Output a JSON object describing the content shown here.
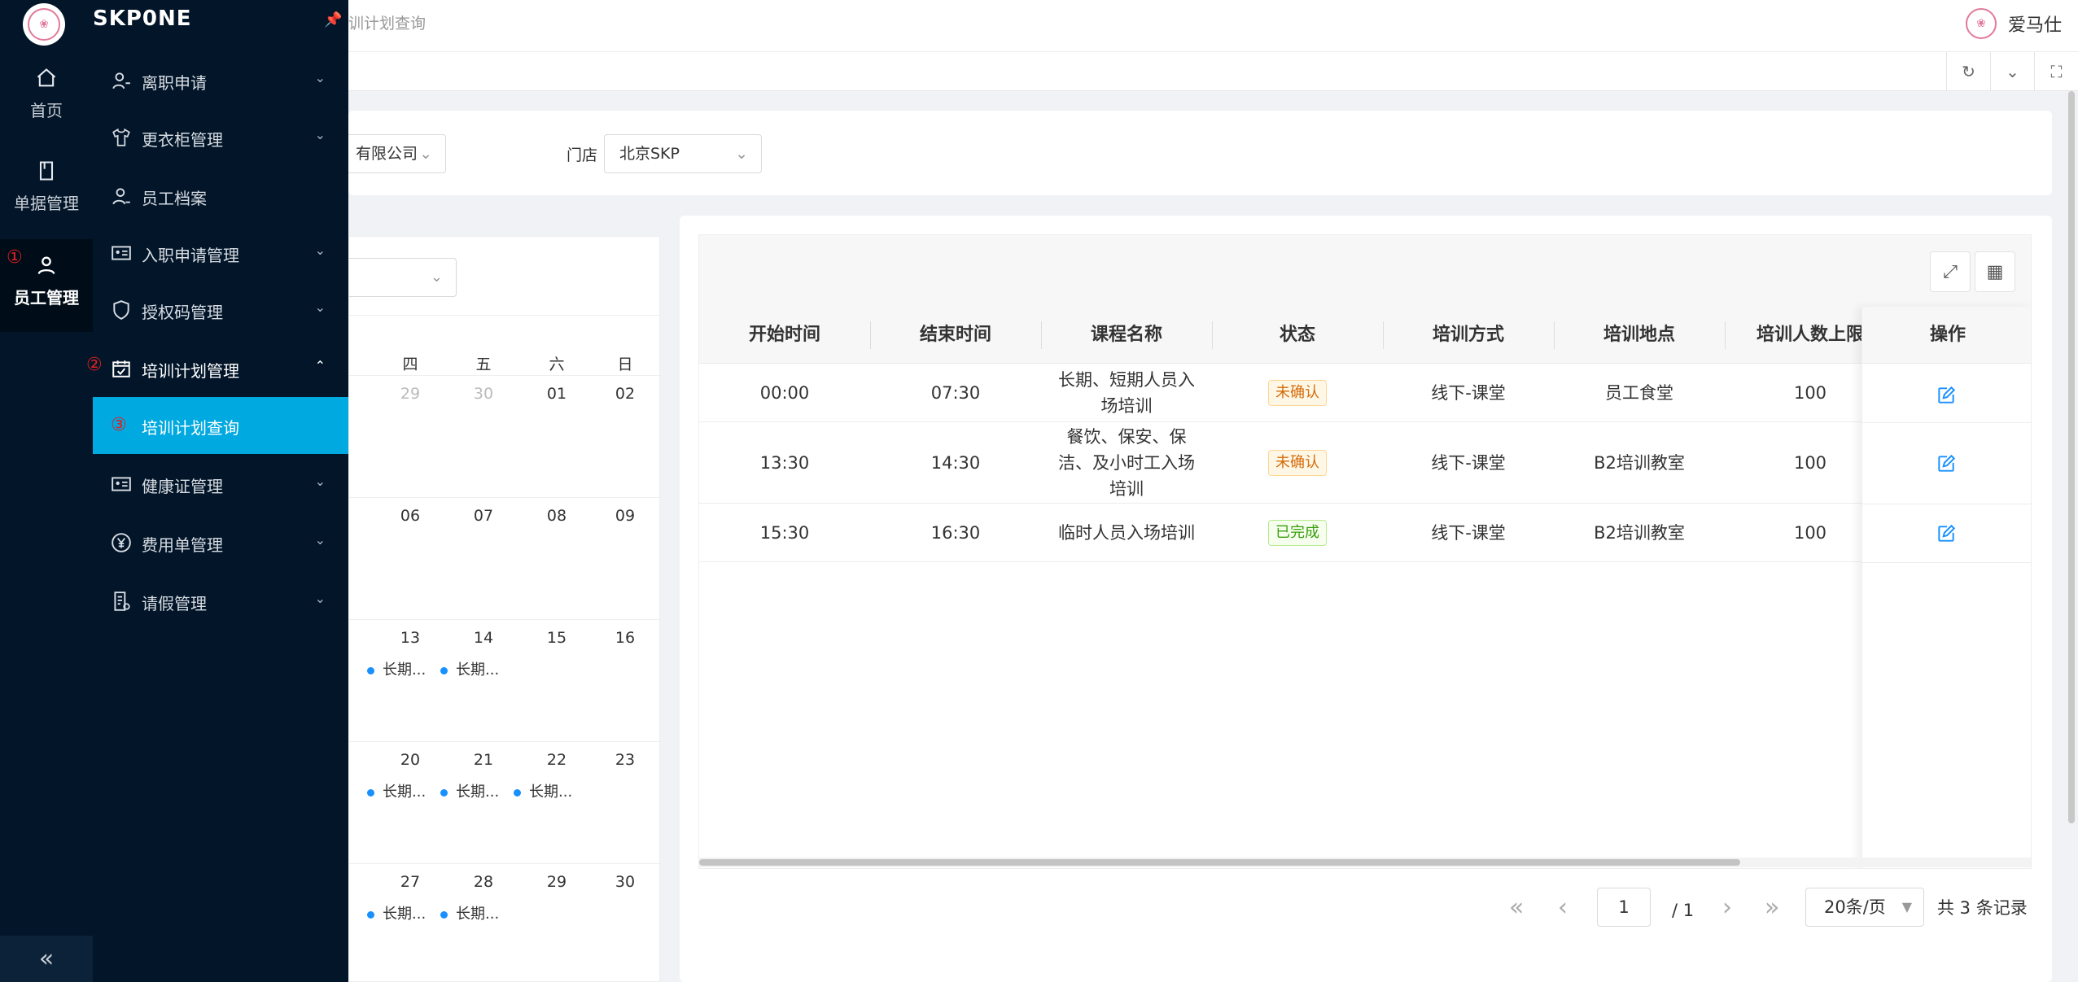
{
  "app": {
    "brand": "SKP0NE",
    "breadcrumb": "训计划查询",
    "user_name": "爱马仕"
  },
  "rail": {
    "items": [
      {
        "label": "首页",
        "icon": "home-icon"
      },
      {
        "label": "单据管理",
        "icon": "document-icon"
      },
      {
        "label": "员工管理",
        "icon": "user-icon",
        "active": true
      }
    ],
    "markers": [
      "①",
      "②",
      "③"
    ]
  },
  "menu": {
    "items": [
      {
        "label": "离职申请",
        "icon": "user-leave-icon",
        "expandable": true
      },
      {
        "label": "更衣柜管理",
        "icon": "shirt-icon",
        "expandable": true
      },
      {
        "label": "员工档案",
        "icon": "profile-icon",
        "expandable": false
      },
      {
        "label": "入职申请管理",
        "icon": "id-card-icon",
        "expandable": true
      },
      {
        "label": "授权码管理",
        "icon": "shield-icon",
        "expandable": true
      },
      {
        "label": "培训计划管理",
        "icon": "calendar-check-icon",
        "expandable": true,
        "open": true
      },
      {
        "label": "培训计划查询",
        "sub": true,
        "active": true
      },
      {
        "label": "健康证管理",
        "icon": "health-card-icon",
        "expandable": true
      },
      {
        "label": "费用单管理",
        "icon": "yen-icon",
        "expandable": true
      },
      {
        "label": "请假管理",
        "icon": "leave-doc-icon",
        "expandable": true
      }
    ]
  },
  "filters": {
    "company_value": "有限公司",
    "store_label": "门店",
    "store_value": "北京SKP"
  },
  "calendar": {
    "weekdays": [
      "四",
      "五",
      "六",
      "日"
    ],
    "weeks": [
      {
        "dates": [
          "29",
          "30",
          "01",
          "02"
        ],
        "muted": [
          true,
          true,
          false,
          false
        ],
        "events": [
          "",
          "",
          "",
          ""
        ]
      },
      {
        "dates": [
          "06",
          "07",
          "08",
          "09"
        ],
        "muted": [
          false,
          false,
          false,
          false
        ],
        "events": [
          "",
          "",
          "",
          ""
        ]
      },
      {
        "dates": [
          "13",
          "14",
          "15",
          "16"
        ],
        "muted": [
          false,
          false,
          false,
          false
        ],
        "events": [
          "长期...",
          "长期...",
          "",
          ""
        ]
      },
      {
        "dates": [
          "20",
          "21",
          "22",
          "23"
        ],
        "muted": [
          false,
          false,
          false,
          false
        ],
        "events": [
          "长期...",
          "长期...",
          "长期...",
          ""
        ]
      },
      {
        "dates": [
          "27",
          "28",
          "29",
          "30"
        ],
        "muted": [
          false,
          false,
          false,
          false
        ],
        "events": [
          "长期...",
          "长期...",
          "",
          ""
        ]
      }
    ]
  },
  "table": {
    "columns": [
      "开始时间",
      "结束时间",
      "课程名称",
      "状态",
      "培训方式",
      "培训地点",
      "培训人数上限"
    ],
    "action_column": "操作",
    "rows": [
      {
        "start": "00:00",
        "end": "07:30",
        "course": "长期、短期人员入场培训",
        "status": "未确认",
        "status_type": "warn",
        "mode": "线下-课堂",
        "place": "员工食堂",
        "limit": "100"
      },
      {
        "start": "13:30",
        "end": "14:30",
        "course": "餐饮、保安、保洁、及小时工入场培训",
        "status": "未确认",
        "status_type": "warn",
        "mode": "线下-课堂",
        "place": "B2培训教室",
        "limit": "100"
      },
      {
        "start": "15:30",
        "end": "16:30",
        "course": "临时人员入场培训",
        "status": "已完成",
        "status_type": "done",
        "mode": "线下-课堂",
        "place": "B2培训教室",
        "limit": "100"
      }
    ]
  },
  "pagination": {
    "current_page": "1",
    "total_pages": "/ 1",
    "page_size": "20条/页",
    "total": "共 3 条记录"
  },
  "colors": {
    "sidebar": "#021529",
    "accent": "#00a9e0",
    "link": "#1890ff"
  }
}
